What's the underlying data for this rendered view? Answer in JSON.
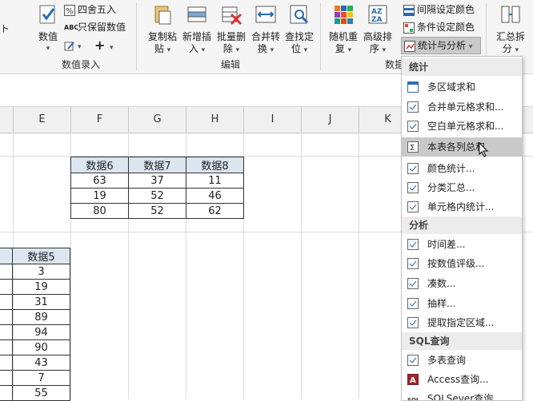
{
  "ribbon": {
    "partial_left": "ト",
    "numeric_button": "数值",
    "round_button": "四舍五入",
    "keep_value_button": "只保留数值",
    "group_numeric": "数值录入",
    "copy_paste": [
      "复制粘",
      "贴"
    ],
    "insert_new": [
      "新增插",
      "入"
    ],
    "batch_delete": [
      "批量删",
      "除"
    ],
    "merge_convert": [
      "合并转",
      "换"
    ],
    "find_locate": [
      "查找定",
      "位"
    ],
    "group_edit": "编辑",
    "random_repeat": [
      "随机重",
      "复"
    ],
    "advanced_sort": [
      "高级排",
      "序"
    ],
    "interval_color": "间隔设定颜色",
    "condition_color": "条件设定颜色",
    "stats_button": "统计与分析",
    "group_data_partial": "数据",
    "summary_split": [
      "汇总拆",
      "分"
    ]
  },
  "sheet": {
    "col_headers": [
      "E",
      "F",
      "G",
      "H",
      "I",
      "J",
      "K"
    ],
    "table1": {
      "headers": [
        "数据6",
        "数据7",
        "数据8"
      ],
      "rows": [
        [
          "63",
          "37",
          "11"
        ],
        [
          "19",
          "52",
          "46"
        ],
        [
          "80",
          "52",
          "62"
        ]
      ]
    },
    "table2": {
      "header": "数据5",
      "values": [
        "3",
        "19",
        "31",
        "89",
        "94",
        "90",
        "43",
        "7",
        "55"
      ]
    }
  },
  "menu": {
    "section_stats": "统计",
    "item_multi_sum": "多区域求和",
    "item_merge_sum": "合并单元格求和...",
    "item_blank_sum": "空白单元格求和...",
    "item_col_total": "本表各列总和",
    "item_color_stats": "颜色统计...",
    "item_subtotal": "分类汇总...",
    "item_cell_stats": "单元格内统计...",
    "section_analysis": "分析",
    "item_time_diff": "时间差...",
    "item_rank": "按数值评级...",
    "item_make_up": "凑数...",
    "item_sample": "抽样...",
    "item_extract": "提取指定区域...",
    "section_sql": "SQL查询",
    "item_multi_query": "多表查询",
    "item_access": "Access查询...",
    "item_sqlserver": "SQLSever查询"
  },
  "colors": {
    "accent_blue": "#2b6cb0",
    "header_fill": "#dce6f1",
    "menu_highlight": "#c9c9c9"
  }
}
